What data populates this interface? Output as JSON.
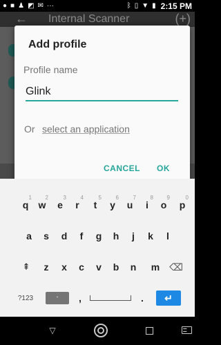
{
  "status_bar": {
    "time": "2:15 PM",
    "icons": [
      "notification-dot-icon",
      "record-icon",
      "person-icon",
      "app-a-icon",
      "gmail-icon",
      "more-dots-icon",
      "bluetooth-icon",
      "vibrate-icon",
      "wifi-icon",
      "battery-icon"
    ]
  },
  "app": {
    "title": "Internal Scanner",
    "back_glyph": "←",
    "add_glyph": "(+)"
  },
  "dialog": {
    "title": "Add profile",
    "field_label": "Profile name",
    "field_value": "Glink",
    "or_text": "Or",
    "select_link": "select an application",
    "cancel_label": "CANCEL",
    "ok_label": "OK",
    "accent_color": "#26a69a"
  },
  "keyboard": {
    "row1": [
      {
        "key": "q",
        "hint": "1"
      },
      {
        "key": "w",
        "hint": "2"
      },
      {
        "key": "e",
        "hint": "3"
      },
      {
        "key": "r",
        "hint": "4"
      },
      {
        "key": "t",
        "hint": "5"
      },
      {
        "key": "y",
        "hint": "6"
      },
      {
        "key": "u",
        "hint": "7"
      },
      {
        "key": "i",
        "hint": "8"
      },
      {
        "key": "o",
        "hint": "9"
      },
      {
        "key": "p",
        "hint": "0"
      }
    ],
    "row2": [
      "a",
      "s",
      "d",
      "f",
      "g",
      "h",
      "j",
      "k",
      "l"
    ],
    "row3": [
      "z",
      "x",
      "c",
      "v",
      "b",
      "n",
      "m"
    ],
    "shift_glyph": "⇞",
    "backspace_glyph": "⌫",
    "symbols_label": "?123",
    "comma": ",",
    "period": ".",
    "enter_glyph": "↵"
  },
  "nav_bar": {
    "back_glyph": "▽"
  }
}
